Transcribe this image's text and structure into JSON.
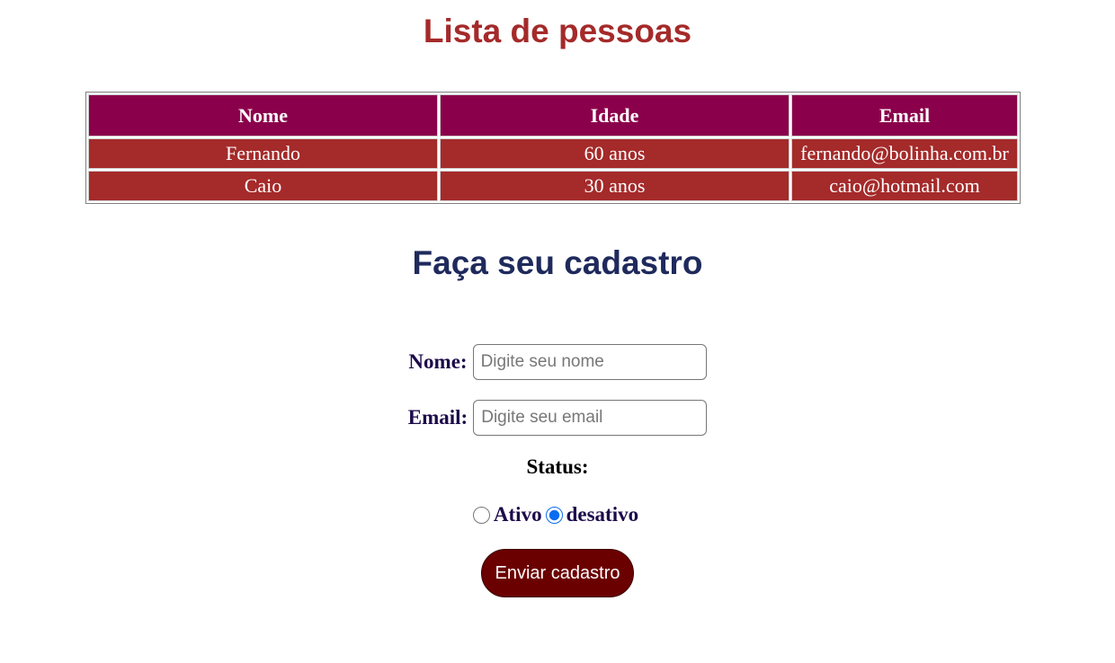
{
  "list_title": "Lista de pessoas",
  "table": {
    "headers": [
      "Nome",
      "Idade",
      "Email"
    ],
    "rows": [
      [
        "Fernando",
        "60 anos",
        "fernando@bolinha.com.br"
      ],
      [
        "Caio",
        "30 anos",
        "caio@hotmail.com"
      ]
    ]
  },
  "form": {
    "title": "Faça seu cadastro",
    "nome_label": "Nome:",
    "nome_placeholder": "Digite seu nome",
    "email_label": "Email:",
    "email_placeholder": "Digite seu email",
    "status_label": "Status:",
    "radio_ativo": "Ativo",
    "radio_desativo": "desativo",
    "selected_status": "desativo",
    "submit_label": "Enviar cadastro"
  },
  "colors": {
    "title_list": "#a52a2a",
    "header_bg": "#8b004b",
    "row_bg": "#a52a2a",
    "title_form": "#1f2a5c",
    "button_bg": "#6b0000"
  }
}
